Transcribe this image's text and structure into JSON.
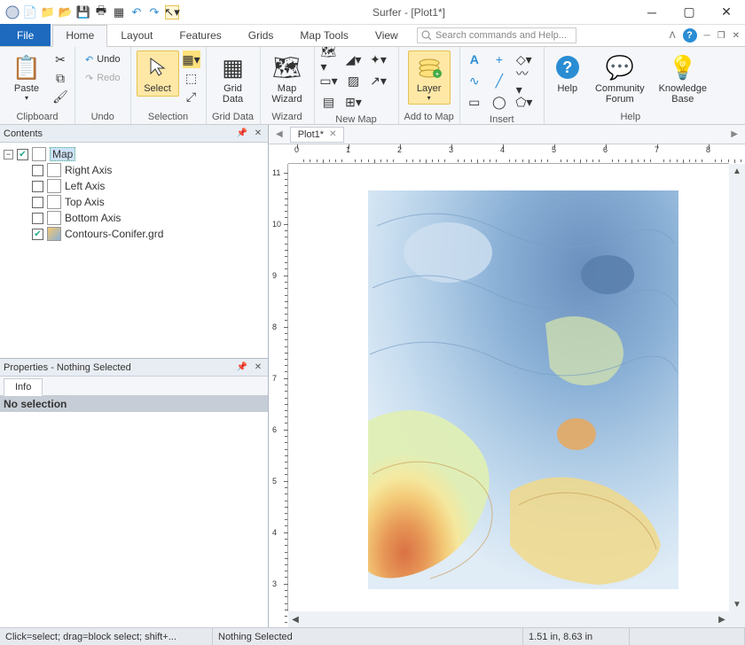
{
  "title": "Surfer - [Plot1*]",
  "tabs": [
    "File",
    "Home",
    "Layout",
    "Features",
    "Grids",
    "Map Tools",
    "View"
  ],
  "active_tab": "Home",
  "search_placeholder": "Search commands and Help...",
  "ribbon": {
    "clipboard": {
      "label": "Clipboard",
      "paste": "Paste"
    },
    "undo_group": {
      "label": "Undo",
      "undo": "Undo",
      "redo": "Redo"
    },
    "selection": {
      "label": "Selection",
      "select": "Select"
    },
    "griddata": {
      "label": "Grid Data",
      "btn": "Grid\nData"
    },
    "wizard": {
      "label": "Wizard",
      "btn": "Map\nWizard"
    },
    "newmap": {
      "label": "New Map"
    },
    "addtomap": {
      "label": "Add to Map",
      "layer": "Layer"
    },
    "insert": {
      "label": "Insert"
    },
    "help": {
      "label": "Help",
      "help": "Help",
      "forum": "Community\nForum",
      "kb": "Knowledge\nBase"
    }
  },
  "contents": {
    "title": "Contents",
    "root": "Map",
    "items": [
      {
        "label": "Right Axis",
        "checked": false
      },
      {
        "label": "Left Axis",
        "checked": false
      },
      {
        "label": "Top Axis",
        "checked": false
      },
      {
        "label": "Bottom Axis",
        "checked": false
      },
      {
        "label": "Contours-Conifer.grd",
        "checked": true,
        "contour": true
      }
    ]
  },
  "properties": {
    "title": "Properties - Nothing Selected",
    "tab": "Info",
    "msg": "No selection"
  },
  "doc_tab": "Plot1*",
  "status": {
    "hint": "Click=select; drag=block select; shift+...",
    "sel": "Nothing Selected",
    "coords": "1.51 in, 8.63 in"
  },
  "ruler_h": [
    "0",
    "1",
    "2",
    "3",
    "4",
    "5",
    "6",
    "7",
    "8"
  ],
  "ruler_v": [
    "11",
    "10",
    "9",
    "8",
    "7",
    "6",
    "5",
    "4",
    "3"
  ]
}
